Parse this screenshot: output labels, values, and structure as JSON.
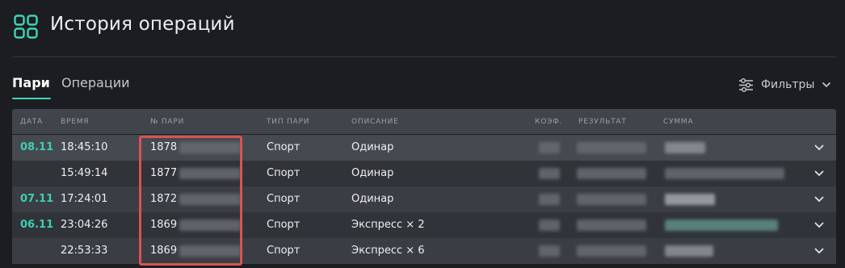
{
  "header": {
    "title": "История операций",
    "logo_icon": "grid-icon",
    "accent_color": "#3fd5b9"
  },
  "tabs": [
    {
      "label": "Пари",
      "active": true
    },
    {
      "label": "Операции",
      "active": false
    }
  ],
  "filters": {
    "label": "Фильтры",
    "icon": "sliders-icon"
  },
  "table": {
    "columns": [
      "ДАТА",
      "ВРЕМЯ",
      "№ ПАРИ",
      "ТИП ПАРИ",
      "ОПИСАНИЕ",
      "КОЭФ.",
      "РЕЗУЛЬТАТ",
      "СУММА"
    ],
    "rows": [
      {
        "date": "08.11",
        "time": "18:45:10",
        "bet_id": "1878",
        "type": "Спорт",
        "description": "Одинар"
      },
      {
        "date": "",
        "time": "15:49:14",
        "bet_id": "1877",
        "type": "Спорт",
        "description": "Одинар"
      },
      {
        "date": "07.11",
        "time": "17:24:01",
        "bet_id": "1872",
        "type": "Спорт",
        "description": "Одинар"
      },
      {
        "date": "06.11",
        "time": "23:04:26",
        "bet_id": "1869",
        "type": "Спорт",
        "description": "Экспресс × 2"
      },
      {
        "date": "",
        "time": "22:53:33",
        "bet_id": "1869",
        "type": "Спорт",
        "description": "Экспресс × 6"
      }
    ]
  }
}
